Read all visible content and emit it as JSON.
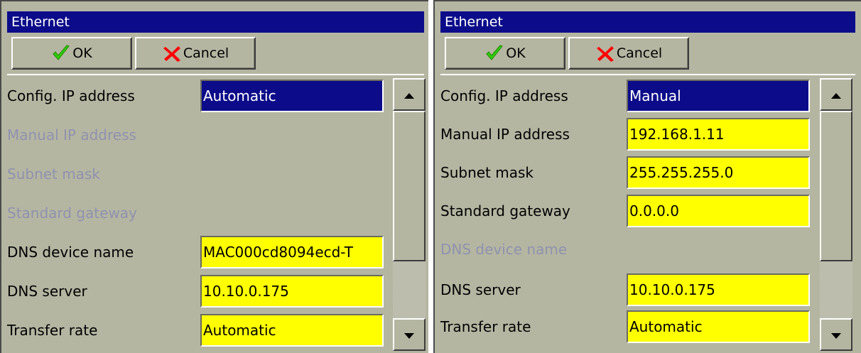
{
  "panels": [
    {
      "title": "Ethernet",
      "ok_label": "OK",
      "cancel_label": "Cancel",
      "rows": [
        {
          "label": "Config. IP address",
          "value": "Automatic",
          "state": "selected"
        },
        {
          "label": "Manual IP address",
          "value": null,
          "state": "disabled"
        },
        {
          "label": "Subnet mask",
          "value": null,
          "state": "disabled"
        },
        {
          "label": "Standard gateway",
          "value": null,
          "state": "disabled"
        },
        {
          "label": "DNS device name",
          "value": "MAC000cd8094ecd-T",
          "state": "yellow"
        },
        {
          "label": "DNS server",
          "value": "10.10.0.175",
          "state": "yellow"
        },
        {
          "label": "Transfer rate",
          "value": "Automatic",
          "state": "yellow"
        }
      ]
    },
    {
      "title": "Ethernet",
      "ok_label": "OK",
      "cancel_label": "Cancel",
      "rows": [
        {
          "label": "Config. IP address",
          "value": "Manual",
          "state": "selected"
        },
        {
          "label": "Manual IP address",
          "value": "192.168.1.11",
          "state": "yellow"
        },
        {
          "label": "Subnet mask",
          "value": "255.255.255.0",
          "state": "yellow"
        },
        {
          "label": "Standard gateway",
          "value": "0.0.0.0",
          "state": "yellow"
        },
        {
          "label": "DNS device name",
          "value": null,
          "state": "disabled"
        },
        {
          "label": "DNS server",
          "value": "10.10.0.175",
          "state": "yellow"
        },
        {
          "label": "Transfer rate",
          "value": "Automatic",
          "state": "yellow"
        }
      ]
    }
  ],
  "icons": {
    "ok": "green-checkmark-icon",
    "cancel": "red-x-icon",
    "scroll_up": "arrow-up-icon",
    "scroll_down": "arrow-down-icon"
  },
  "colors": {
    "dialog_background": "#b5b6a2",
    "title_bar": "#0c0c8a",
    "field_yellow": "#ffff00",
    "field_selected": "#0c0c8a",
    "disabled_text": "#8f92ad",
    "ok_check": "#33cc00",
    "cancel_x": "#ff0000"
  },
  "scroll": {
    "position_fraction": 0.0
  }
}
